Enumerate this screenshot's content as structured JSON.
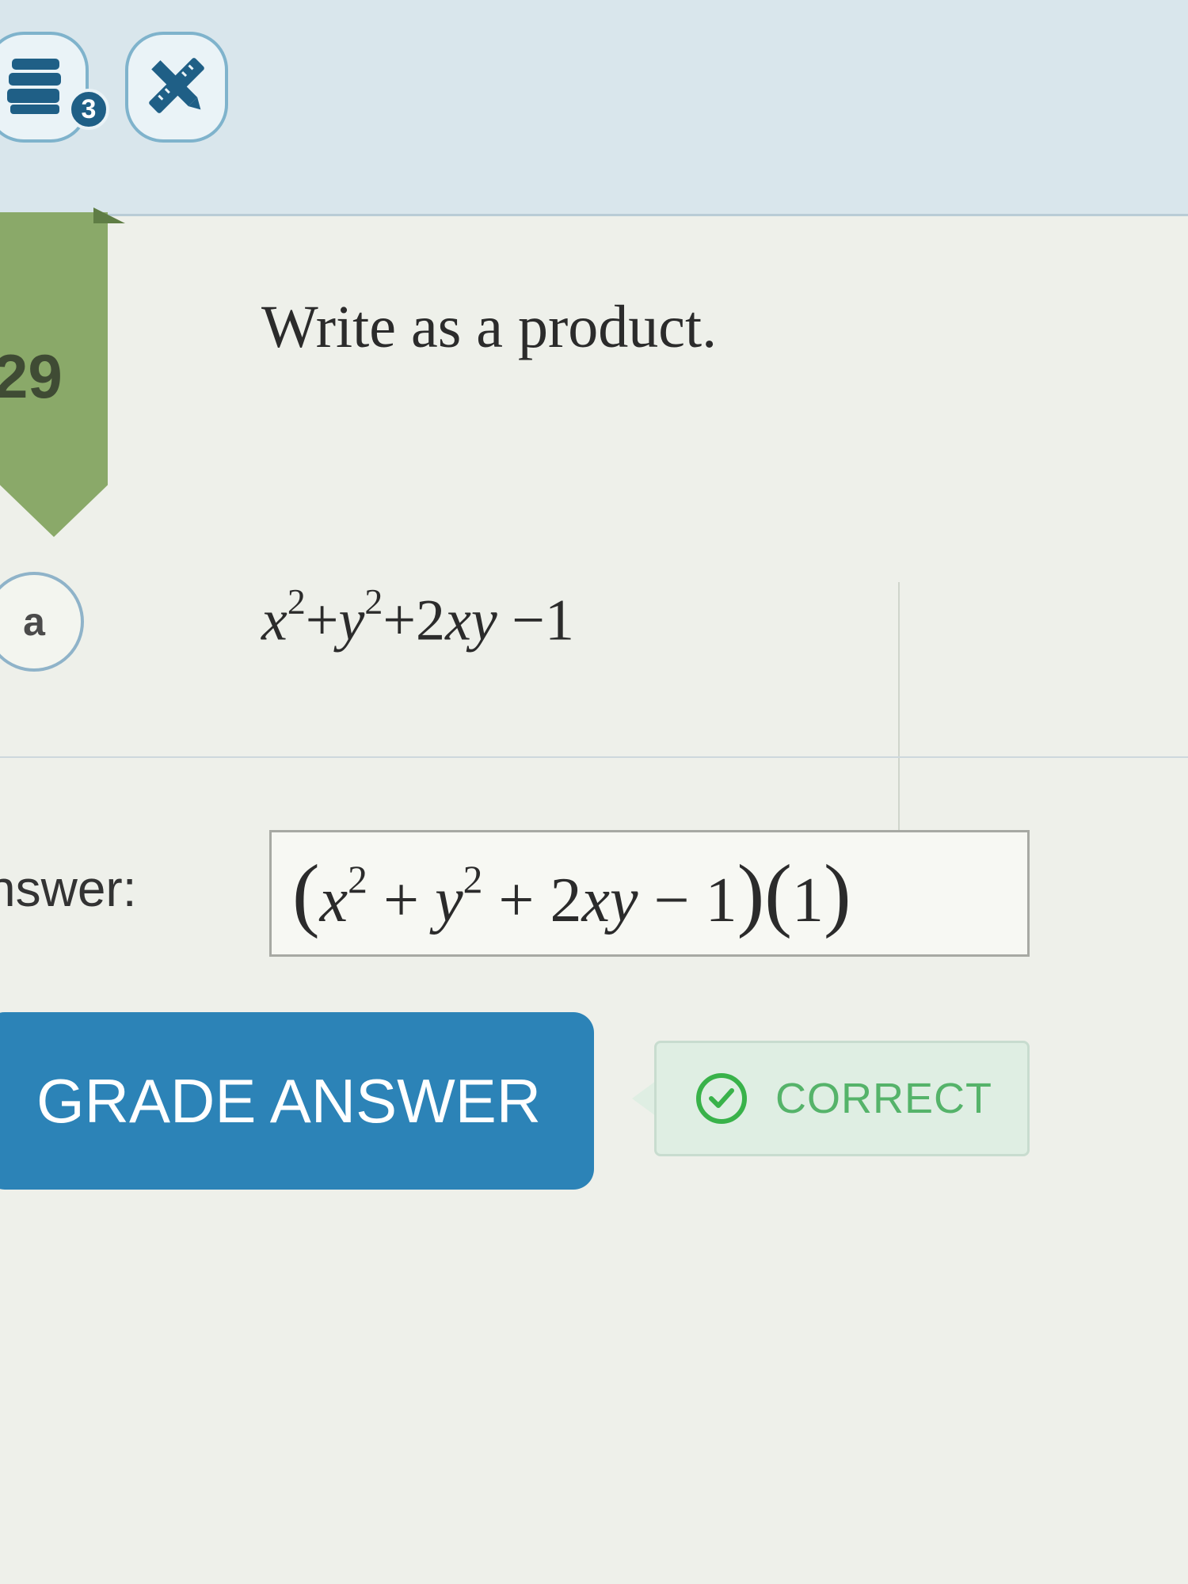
{
  "toolbar": {
    "calculator_icon": "calculator-stack-icon",
    "calculator_count": "3",
    "tools_icon": "pencil-ruler-icon"
  },
  "question": {
    "number": "29",
    "prompt": "Write as a product.",
    "part_label": "a",
    "expression": "x^2+y^2+2xy −1"
  },
  "answer": {
    "label": "nswer:",
    "value": "(x^2+y^2+2xy−1)(1)"
  },
  "actions": {
    "grade_label": "GRADE ANSWER"
  },
  "feedback": {
    "status": "CORRECT",
    "icon": "check-circle-icon",
    "color": "#39b24a"
  },
  "colors": {
    "toolbar_bg": "#d9e6ec",
    "ribbon": "#8aa969",
    "button": "#2c83b7"
  }
}
